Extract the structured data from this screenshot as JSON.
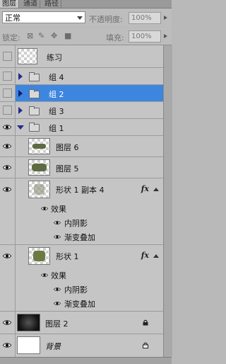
{
  "tabs": [
    {
      "label": "图层"
    },
    {
      "label": "通道"
    },
    {
      "label": "路径"
    }
  ],
  "blend_mode": "正常",
  "opacity_label": "不透明度:",
  "opacity_value": "100%",
  "lock_label": "锁定:",
  "fill_label": "填充:",
  "fill_value": "100%",
  "layers": {
    "l0": {
      "name": "练习"
    },
    "g4": {
      "name": "组 4"
    },
    "g2": {
      "name": "组 2"
    },
    "g3": {
      "name": "组 3"
    },
    "g1": {
      "name": "组 1"
    },
    "l6": {
      "name": "图层 6"
    },
    "l5": {
      "name": "图层 5"
    },
    "s4": {
      "name": "形状 1 副本 4",
      "fx": "fx",
      "effects_label": "效果",
      "effects": [
        "内阴影",
        "渐变叠加"
      ]
    },
    "s1": {
      "name": "形状 1",
      "fx": "fx",
      "effects_label": "效果",
      "effects": [
        "内阴影",
        "渐变叠加"
      ]
    },
    "l2": {
      "name": "图层 2"
    },
    "bg": {
      "name": "背景"
    }
  },
  "colors": {
    "selection": "#3d86e0",
    "shape_green": "#6b7a45"
  },
  "icons": [
    "eye-icon",
    "folder-icon",
    "triangle-expand-icon",
    "lock-icon",
    "chain-icon",
    "brush-icon",
    "move-icon"
  ]
}
